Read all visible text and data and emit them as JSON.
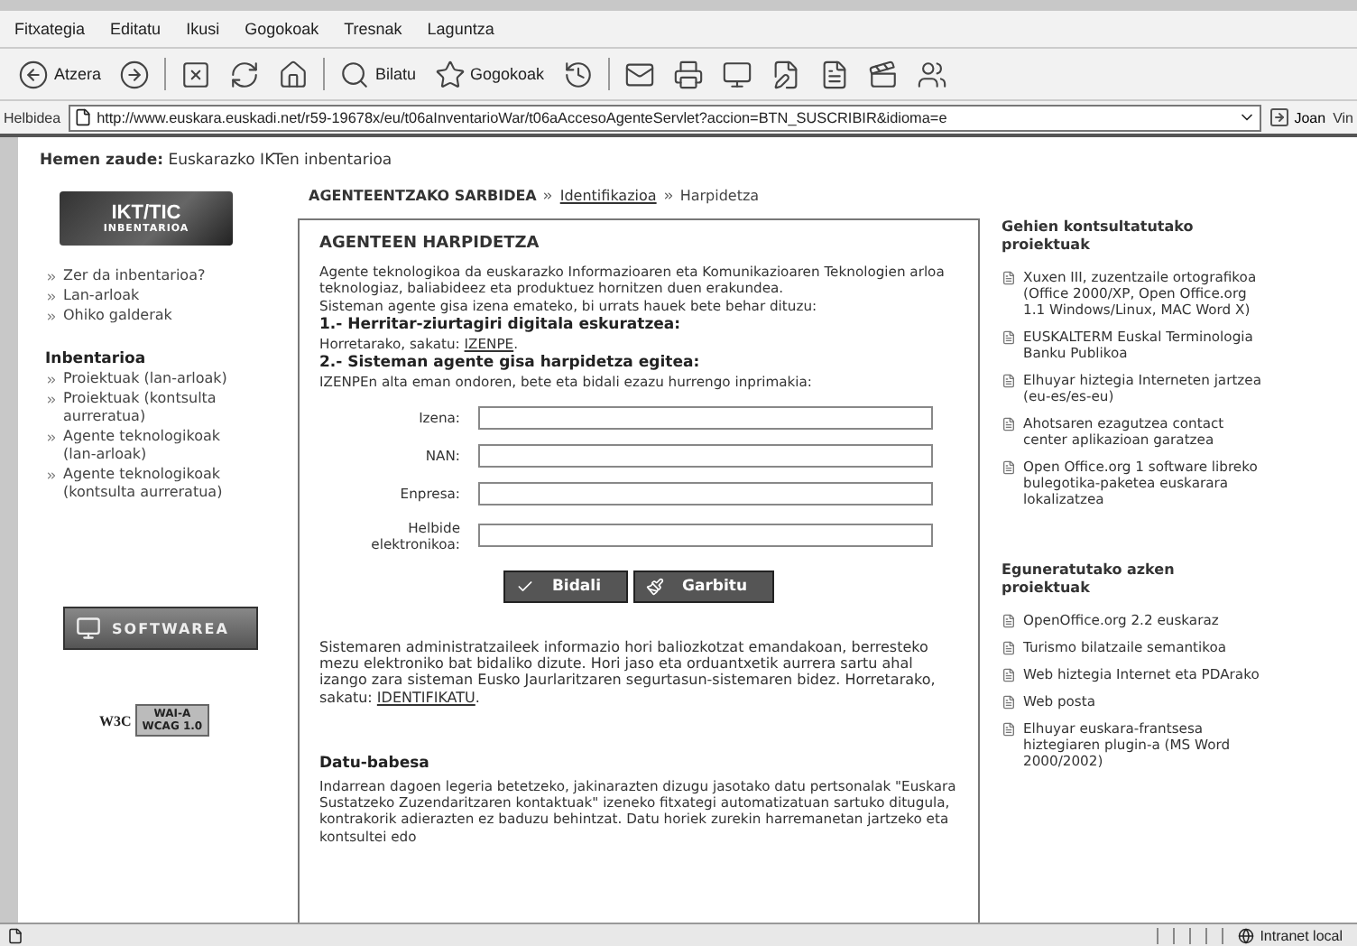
{
  "menu": [
    "Fitxategia",
    "Editatu",
    "Ikusi",
    "Gogokoak",
    "Tresnak",
    "Laguntza"
  ],
  "toolbar": [
    {
      "kind": "back",
      "label": "Atzera"
    },
    {
      "kind": "forward"
    },
    {
      "kind": "sep"
    },
    {
      "kind": "stop"
    },
    {
      "kind": "refresh"
    },
    {
      "kind": "home"
    },
    {
      "kind": "sep"
    },
    {
      "kind": "search",
      "label": "Bilatu"
    },
    {
      "kind": "favorites",
      "label": "Gogokoak"
    },
    {
      "kind": "history"
    },
    {
      "kind": "sep"
    },
    {
      "kind": "mail"
    },
    {
      "kind": "print"
    },
    {
      "kind": "media"
    },
    {
      "kind": "edit"
    },
    {
      "kind": "notes"
    },
    {
      "kind": "tools"
    },
    {
      "kind": "people"
    }
  ],
  "address_bar": {
    "label": "Helbidea",
    "url": "http://www.euskara.euskadi.net/r59-19678x/eu/t06aInventarioWar/t06aAccesoAgenteServlet?accion=BTN_SUSCRIBIR&idioma=e",
    "go": "Joan",
    "links": "Vin"
  },
  "location": {
    "label": "Hemen zaude:",
    "text": "Euskarazko IKTen inbentarioa"
  },
  "logo": {
    "title": "IKT/TIC",
    "subtitle": "INBENTARIOA"
  },
  "sidebar": {
    "links": [
      "Zer da inbentarioa?",
      "Lan-arloak",
      "Ohiko galderak"
    ],
    "section": "Inbentarioa",
    "section_links": [
      "Proiektuak (lan-arloak)",
      "Proiektuak (kontsulta aurreratua)",
      "Agente teknologikoak (lan-arloak)",
      "Agente teknologikoak (kontsulta aurreratua)"
    ],
    "banner": "SOFTWAREA",
    "badge": {
      "left": "W3C",
      "top": "WAI-A",
      "bottom": "WCAG 1.0"
    }
  },
  "breadcrumb": [
    {
      "text": "AGENTEENTZAKO SARBIDEA",
      "kind": "current"
    },
    {
      "text": "Identifikazioa",
      "kind": "link"
    },
    {
      "text": "Harpidetza",
      "kind": "plain"
    }
  ],
  "form": {
    "title": "AGENTEEN HARPIDETZA",
    "intro": "Agente teknologikoa da euskarazko Informazioaren eta Komunikazioaren Teknologien arloa teknologiaz, baliabideez eta produktuez hornitzen duen erakundea.",
    "intro2": "Sisteman agente gisa izena emateko, bi urrats hauek bete behar dituzu:",
    "steps": [
      {
        "title": "1.- Herritar-ziurtagiri digitala eskuratzea:",
        "before": "Horretarako, sakatu: ",
        "link": "IZENPE",
        "after": "."
      },
      {
        "title": "2.- Sisteman agente gisa harpidetza egitea:",
        "before": "IZENPEn alta eman ondoren, bete eta bidali ezazu hurrengo inprimakia:"
      }
    ],
    "fields": [
      "Izena:",
      "NAN:",
      "Enpresa:",
      "Helbide elektronikoa:"
    ],
    "buttons": [
      {
        "kind": "submit",
        "label": "Bidali"
      },
      {
        "kind": "reset",
        "label": "Garbitu"
      }
    ],
    "note": {
      "before": "Sistemaren administratzaileek informazio hori baliozkotzat emandakoan, berresteko mezu elektroniko bat bidaliko dizute. Hori jaso eta orduantxetik aurrera sartu ahal izango zara sisteman Eusko Jaurlaritzaren segurtasun-sistemaren bidez. Horretarako, sakatu: ",
      "link": "IDENTIFIKATU",
      "after": "."
    },
    "privacy_title": "Datu-babesa",
    "privacy": "Indarrean dagoen legeria betetzeko, jakinarazten dizugu jasotako datu pertsonalak \"Euskara Sustatzeko Zuzendaritzaren kontaktuak\" izeneko fitxategi automatizatuan sartuko ditugula, kontrakorik adierazten ez baduzu behintzat. Datu horiek zurekin harremanetan jartzeko eta kontsultei edo"
  },
  "right": [
    {
      "heading": "Gehien kontsultatutako proiektuak",
      "items": [
        "Xuxen III, zuzentzaile ortografikoa (Office 2000/XP, Open Office.org 1.1 Windows/Linux, MAC Word X)",
        "EUSKALTERM Euskal Terminologia Banku Publikoa",
        "Elhuyar hiztegia Interneten jartzea (eu-es/es-eu)",
        "Ahotsaren ezagutzea contact center aplikazioan garatzea",
        "Open Office.org 1 software libreko bulegotika-paketea euskarara lokalizatzea"
      ]
    },
    {
      "heading": "Eguneratutako azken proiektuak",
      "items": [
        "OpenOffice.org 2.2 euskaraz",
        "Turismo bilatzaile semantikoa",
        "Web hiztegia Internet eta PDArako",
        "Web posta",
        "Elhuyar euskara-frantsesa hiztegiaren plugin-a (MS Word 2000/2002)"
      ]
    }
  ],
  "status_bar": {
    "zone": "Intranet local"
  }
}
